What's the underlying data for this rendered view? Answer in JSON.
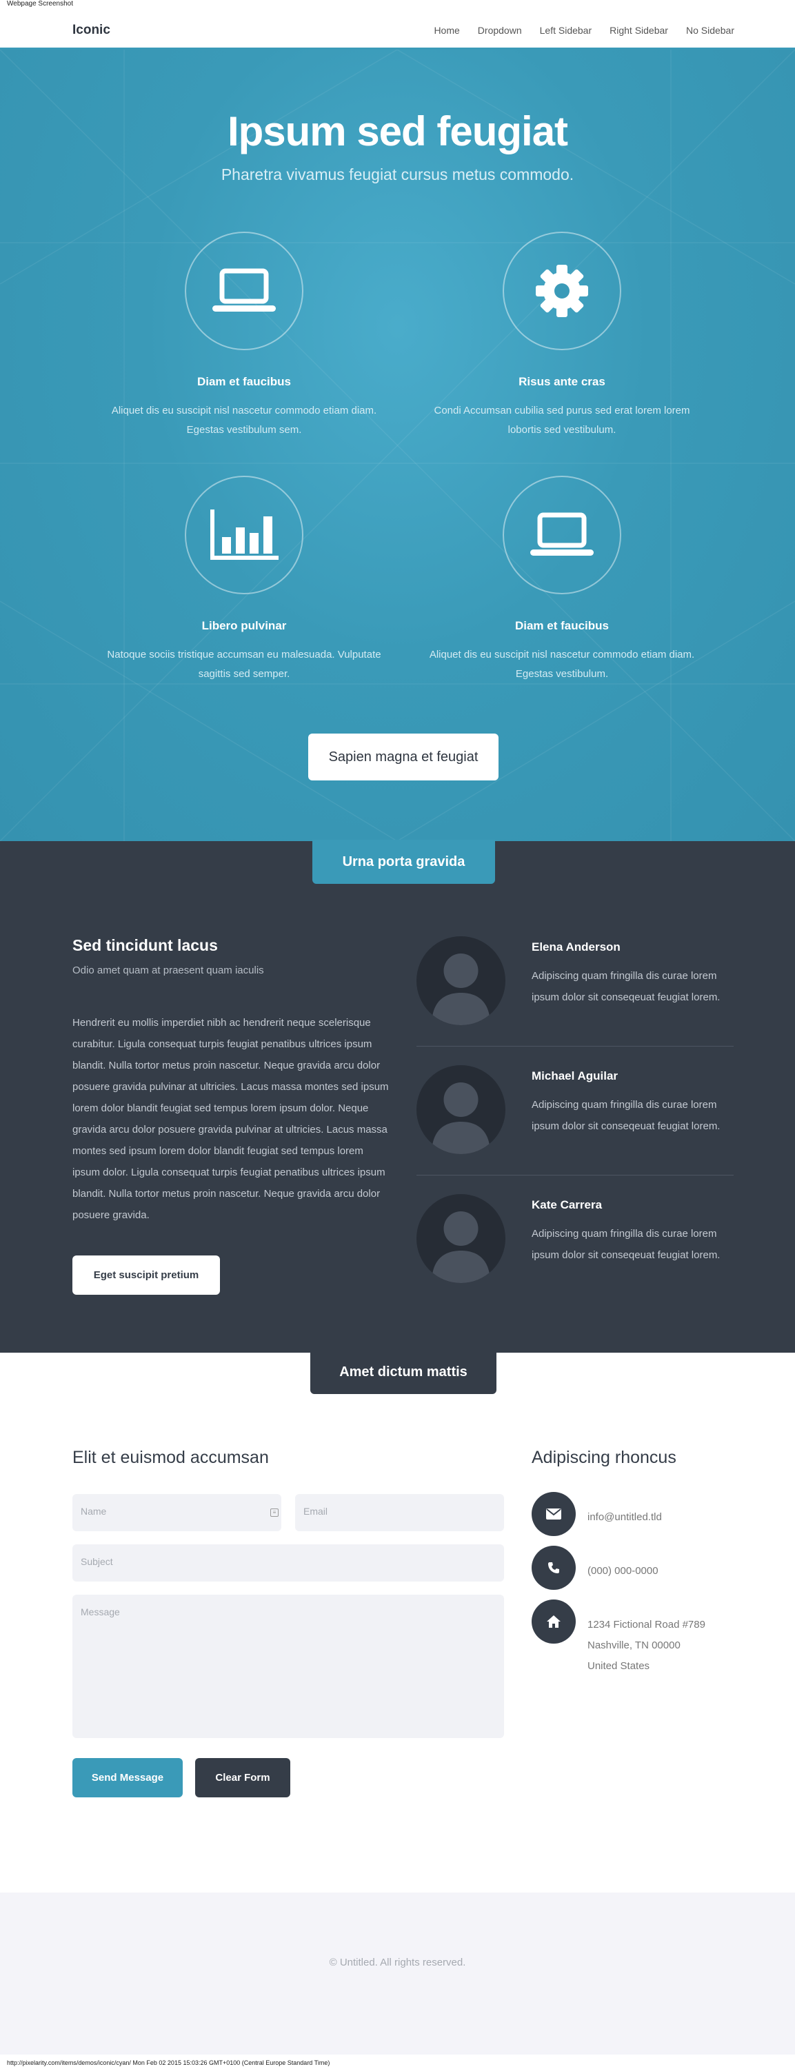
{
  "screenshot": {
    "caption": "Webpage Screenshot",
    "footer_url": "http://pixelarity.com/items/demos/iconic/cyan/ Mon Feb 02 2015 15:03:26 GMT+0100 (Central Europe Standard Time)"
  },
  "header": {
    "logo": "Iconic",
    "nav": [
      "Home",
      "Dropdown",
      "Left Sidebar",
      "Right Sidebar",
      "No Sidebar"
    ]
  },
  "hero": {
    "title": "Ipsum sed feugiat",
    "subtitle": "Pharetra vivamus feugiat cursus metus commodo.",
    "features": [
      {
        "icon": "laptop-icon",
        "title": "Diam et faucibus",
        "text": "Aliquet dis eu suscipit nisl nascetur commodo etiam diam. Egestas vestibulum sem."
      },
      {
        "icon": "gear-icon",
        "title": "Risus ante cras",
        "text": "Condi Accumsan cubilia sed purus sed erat lorem lorem lobortis sed vestibulum."
      },
      {
        "icon": "bar-chart-icon",
        "title": "Libero pulvinar",
        "text": "Natoque sociis tristique accumsan eu malesuada. Vulputate sagittis sed semper."
      },
      {
        "icon": "laptop-icon",
        "title": "Diam et faucibus",
        "text": "Aliquet dis eu suscipit nisl nascetur commodo etiam diam. Egestas vestibulum."
      }
    ],
    "button": "Sapien magna et feugiat"
  },
  "team": {
    "tab": "Urna porta gravida",
    "heading": "Sed tincidunt lacus",
    "tagline": "Odio amet quam at praesent quam iaculis",
    "body": "Hendrerit eu mollis imperdiet nibh ac hendrerit neque scelerisque curabitur. Ligula consequat turpis feugiat penatibus ultrices ipsum blandit. Nulla tortor metus proin nascetur. Neque gravida arcu dolor posuere gravida pulvinar at ultricies. Lacus massa montes sed ipsum lorem dolor blandit feugiat sed tempus lorem ipsum dolor. Neque gravida arcu dolor posuere gravida pulvinar at ultricies. Lacus massa montes sed ipsum lorem dolor blandit feugiat sed tempus lorem ipsum dolor. Ligula consequat turpis feugiat penatibus ultrices ipsum blandit. Nulla tortor metus proin nascetur. Neque gravida arcu dolor posuere gravida.",
    "button": "Eget suscipit pretium",
    "members": [
      {
        "name": "Elena Anderson",
        "text": "Adipiscing quam fringilla dis curae lorem ipsum dolor sit conseqeuat feugiat lorem."
      },
      {
        "name": "Michael Aguilar",
        "text": "Adipiscing quam fringilla dis curae lorem ipsum dolor sit conseqeuat feugiat lorem."
      },
      {
        "name": "Kate Carrera",
        "text": "Adipiscing quam fringilla dis curae lorem ipsum dolor sit conseqeuat feugiat lorem."
      }
    ]
  },
  "contact": {
    "tab": "Amet dictum mattis",
    "form_title": "Elit et euismod accumsan",
    "placeholders": {
      "name": "Name",
      "email": "Email",
      "subject": "Subject",
      "message": "Message"
    },
    "send": "Send Message",
    "clear": "Clear Form",
    "info_title": "Adipiscing rhoncus",
    "email": "info@untitled.tld",
    "phone": "(000) 000-0000",
    "address": [
      "1234 Fictional Road #789",
      "Nashville, TN 00000",
      "United States"
    ]
  },
  "footer": {
    "copyright": "© Untitled. All rights reserved."
  },
  "colors": {
    "accent": "#3a9ab8",
    "dark": "#353d48",
    "light_bg": "#f4f4f9"
  }
}
